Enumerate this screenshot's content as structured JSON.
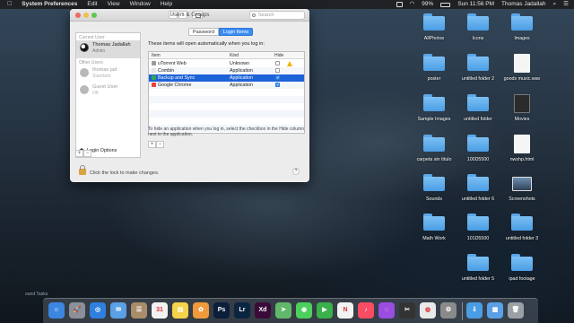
{
  "menubar": {
    "app_name": "System Preferences",
    "menus": [
      "Edit",
      "View",
      "Window",
      "Help"
    ],
    "battery": "99%",
    "clock": "Sun 11:56 PM",
    "user": "Thomas Jadallah"
  },
  "window": {
    "title": "Users & Groups",
    "search_placeholder": "Search",
    "sidebar": {
      "current_user_heading": "Current User",
      "other_users_heading": "Other Users",
      "users": [
        {
          "name": "Thomas Jadallah",
          "role": "Admin"
        },
        {
          "name": "thomas jad",
          "role": "Standard"
        },
        {
          "name": "Guest User",
          "role": "Off"
        }
      ],
      "login_options": "Login Options",
      "add": "+",
      "remove": "−"
    },
    "tabs": {
      "password": "Password",
      "login_items": "Login Items"
    },
    "intro": "These items will open automatically when you log in:",
    "columns": {
      "item": "Item",
      "kind": "Kind",
      "hide": "Hide"
    },
    "items": [
      {
        "name": "uTorrent Web",
        "kind": "Unknown",
        "hide": false,
        "warning": true,
        "icon_color": "#9a9a9a"
      },
      {
        "name": "Combin",
        "kind": "Application",
        "hide": false,
        "warning": false,
        "icon_color": "#e5e5e5"
      },
      {
        "name": "Backup and Sync",
        "kind": "Application",
        "hide": true,
        "warning": false,
        "icon_color": "#34a853"
      },
      {
        "name": "Google Chrome",
        "kind": "Application",
        "hide": true,
        "warning": false,
        "icon_color": "#ea4335"
      }
    ],
    "help_text": "To hide an application when you log in, select the checkbox in the Hide column next to the application.",
    "lock_text": "Click the lock to make changes.",
    "help_button": "?"
  },
  "desktop": {
    "icons": [
      {
        "label": "AllPhotos",
        "type": "folder"
      },
      {
        "label": "Icons",
        "type": "folder"
      },
      {
        "label": "Images",
        "type": "folder"
      },
      {
        "label": "poster",
        "type": "folder"
      },
      {
        "label": "untitled folder 2",
        "type": "folder"
      },
      {
        "label": "goods music.wav",
        "type": "file"
      },
      {
        "label": "Sample Images",
        "type": "folder"
      },
      {
        "label": "untitled folder",
        "type": "folder"
      },
      {
        "label": "Movies",
        "type": "dark"
      },
      {
        "label": "carpeta sin título",
        "type": "folder"
      },
      {
        "label": "100D5500",
        "type": "folder"
      },
      {
        "label": "nwshp.html",
        "type": "file"
      },
      {
        "label": "Sounds",
        "type": "folder"
      },
      {
        "label": "untitled folder 6",
        "type": "folder"
      },
      {
        "label": "Screenshots",
        "type": "shot"
      },
      {
        "label": "Math Work",
        "type": "folder"
      },
      {
        "label": "101D5500",
        "type": "folder"
      },
      {
        "label": "untitled folder 3",
        "type": "folder"
      },
      {
        "label": "untitled folder 5",
        "type": "folder"
      },
      {
        "label": "ipad footage",
        "type": "folder"
      }
    ]
  },
  "dock": {
    "apps": [
      {
        "name": "finder",
        "glyph": "☺",
        "color": "#3a86e0"
      },
      {
        "name": "launchpad",
        "glyph": "🚀",
        "color": "#8a8f99"
      },
      {
        "name": "safari",
        "glyph": "◎",
        "color": "#2f7fe0"
      },
      {
        "name": "mail",
        "glyph": "✉",
        "color": "#5aa0e6"
      },
      {
        "name": "contacts",
        "glyph": "☰",
        "color": "#a98c6a"
      },
      {
        "name": "calendar",
        "glyph": "31",
        "color": "#f2f2f2"
      },
      {
        "name": "notes",
        "glyph": "▤",
        "color": "#f5d34a"
      },
      {
        "name": "photos",
        "glyph": "✿",
        "color": "#f09a3c"
      },
      {
        "name": "photoshop",
        "glyph": "Ps",
        "color": "#0c1e3a"
      },
      {
        "name": "lightroom",
        "glyph": "Lr",
        "color": "#0a2540"
      },
      {
        "name": "xd",
        "glyph": "Xd",
        "color": "#3a0b3a"
      },
      {
        "name": "maps",
        "glyph": "➤",
        "color": "#62b86a"
      },
      {
        "name": "messages",
        "glyph": "◉",
        "color": "#4ccf5b"
      },
      {
        "name": "facetime",
        "glyph": "▶",
        "color": "#3ab04a"
      },
      {
        "name": "news",
        "glyph": "N",
        "color": "#f2f2f2"
      },
      {
        "name": "music",
        "glyph": "♪",
        "color": "#fa4c63"
      },
      {
        "name": "podcasts",
        "glyph": "◌",
        "color": "#9a4de0"
      },
      {
        "name": "final-cut",
        "glyph": "✂",
        "color": "#333"
      },
      {
        "name": "chrome",
        "glyph": "◍",
        "color": "#e9e9e9"
      },
      {
        "name": "system-preferences",
        "glyph": "⚙",
        "color": "#8a8a8a"
      }
    ],
    "right_items": [
      {
        "name": "downloads",
        "glyph": "⇩",
        "color": "#4a9de4"
      },
      {
        "name": "documents",
        "glyph": "▦",
        "color": "#5aa0e6"
      },
      {
        "name": "trash",
        "glyph": "🗑",
        "color": "#9aa0a6"
      }
    ]
  },
  "bottom_text": "ound Tasks"
}
